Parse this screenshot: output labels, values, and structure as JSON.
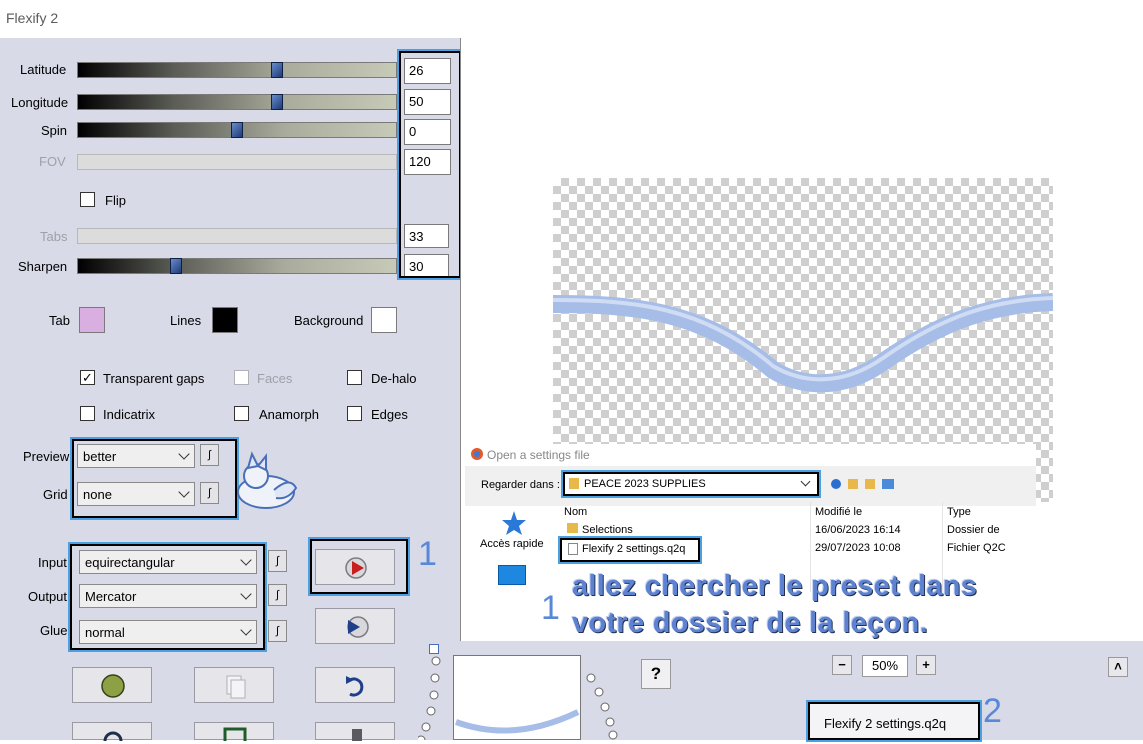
{
  "window": {
    "title": "Flexify 2"
  },
  "sliders": [
    {
      "label": "Latitude",
      "value": "26",
      "fraction": 0.63,
      "enabled": true
    },
    {
      "label": "Longitude",
      "value": "50",
      "fraction": 0.63,
      "enabled": true
    },
    {
      "label": "Spin",
      "value": "0",
      "fraction": 0.5,
      "enabled": true
    },
    {
      "label": "FOV",
      "value": "120",
      "fraction": null,
      "enabled": false
    },
    {
      "label": "Tabs",
      "value": "33",
      "fraction": null,
      "enabled": false
    },
    {
      "label": "Sharpen",
      "value": "30",
      "fraction": 0.3,
      "enabled": true
    }
  ],
  "flip": {
    "label": "Flip",
    "checked": false
  },
  "colors": {
    "tab": {
      "label": "Tab",
      "hex": "#d9aee0"
    },
    "lines": {
      "label": "Lines",
      "hex": "#000000"
    },
    "background": {
      "label": "Background",
      "hex": "#ffffff"
    },
    "highlight": "#4aa0e0",
    "annotation": "#5a88d8"
  },
  "checkboxes": {
    "transparent_gaps": {
      "label": "Transparent gaps",
      "checked": true
    },
    "faces": {
      "label": "Faces",
      "checked": false
    },
    "de_halo": {
      "label": "De-halo",
      "checked": false
    },
    "indicatrix": {
      "label": "Indicatrix",
      "checked": false
    },
    "anamorph": {
      "label": "Anamorph",
      "checked": false
    },
    "edges": {
      "label": "Edges",
      "checked": false
    }
  },
  "preview": {
    "label": "Preview",
    "value": "better"
  },
  "grid": {
    "label": "Grid",
    "value": "none"
  },
  "input": {
    "label": "Input",
    "value": "equirectangular"
  },
  "output": {
    "label": "Output",
    "value": "Mercator"
  },
  "glue": {
    "label": "Glue",
    "value": "normal"
  },
  "lock_glyph": "∫",
  "annotations": {
    "one": "1",
    "two": "2"
  },
  "instruction": {
    "line1": "allez chercher le preset dans",
    "line2": "votre dossier de la leçon."
  },
  "dialog": {
    "title": "Open a settings file",
    "look_in_label": "Regarder dans :",
    "folder": "PEACE 2023 SUPPLIES",
    "quick_access": "Accès rapide",
    "columns": [
      "Nom",
      "Modifié le",
      "Type"
    ],
    "rows": [
      {
        "name": "Selections",
        "modified": "16/06/2023 16:14",
        "type": "Dossier de",
        "icon": "folder-icon"
      },
      {
        "name": "Flexify 2 settings.q2q",
        "modified": "29/07/2023 10:08",
        "type": "Fichier Q2C",
        "icon": "file-icon"
      }
    ]
  },
  "zoom": {
    "minus": "−",
    "value": "50%",
    "plus": "+"
  },
  "help": "?",
  "scroll_up": "˄",
  "filename_box": "Flexify 2 settings.q2q"
}
